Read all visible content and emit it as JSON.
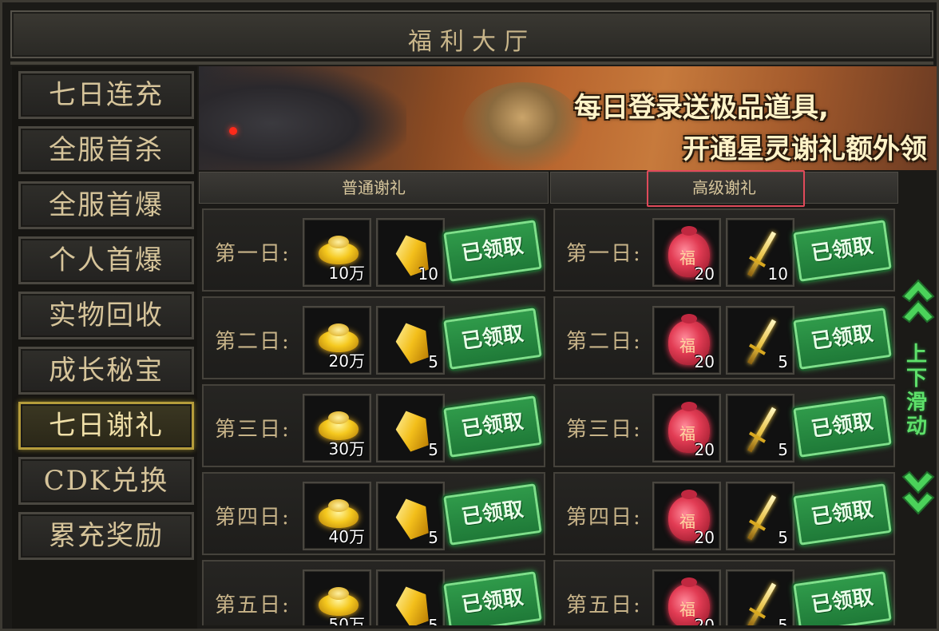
{
  "window": {
    "title": "福利大厅"
  },
  "sidebar": {
    "items": [
      {
        "label": "七日连充",
        "active": false
      },
      {
        "label": "全服首杀",
        "active": false
      },
      {
        "label": "全服首爆",
        "active": false
      },
      {
        "label": "个人首爆",
        "active": false
      },
      {
        "label": "实物回收",
        "active": false
      },
      {
        "label": "成长秘宝",
        "active": false
      },
      {
        "label": "七日谢礼",
        "active": true
      },
      {
        "label": "CDK兑换",
        "active": false
      },
      {
        "label": "累充奖励",
        "active": false
      }
    ]
  },
  "banner": {
    "line1": "每日登录送极品道具,",
    "line2": "开通星灵谢礼额外领取高级谢礼!"
  },
  "columns": {
    "normal": {
      "label": "普通谢礼"
    },
    "advanced": {
      "label": "高级谢礼"
    }
  },
  "claimed_label": "已领取",
  "normal_rows": [
    {
      "day": "第一日:",
      "items": [
        {
          "icon": "gold-ingot-icon",
          "qty": "10万"
        },
        {
          "icon": "gold-crystal-icon",
          "qty": "10"
        }
      ],
      "status": "已领取"
    },
    {
      "day": "第二日:",
      "items": [
        {
          "icon": "gold-ingot-icon",
          "qty": "20万"
        },
        {
          "icon": "gold-crystal-icon",
          "qty": "5"
        }
      ],
      "status": "已领取"
    },
    {
      "day": "第三日:",
      "items": [
        {
          "icon": "gold-ingot-icon",
          "qty": "30万"
        },
        {
          "icon": "gold-crystal-icon",
          "qty": "5"
        }
      ],
      "status": "已领取"
    },
    {
      "day": "第四日:",
      "items": [
        {
          "icon": "gold-ingot-icon",
          "qty": "40万"
        },
        {
          "icon": "gold-crystal-icon",
          "qty": "5"
        }
      ],
      "status": "已领取"
    },
    {
      "day": "第五日:",
      "items": [
        {
          "icon": "gold-ingot-icon",
          "qty": "50万"
        },
        {
          "icon": "gold-crystal-icon",
          "qty": "5"
        }
      ],
      "status": "已领取"
    }
  ],
  "advanced_rows": [
    {
      "day": "第一日:",
      "items": [
        {
          "icon": "red-lucky-bag-icon",
          "qty": "20"
        },
        {
          "icon": "golden-sword-icon",
          "qty": "10"
        }
      ],
      "status": "已领取"
    },
    {
      "day": "第二日:",
      "items": [
        {
          "icon": "red-lucky-bag-icon",
          "qty": "20"
        },
        {
          "icon": "golden-sword-icon",
          "qty": "5"
        }
      ],
      "status": "已领取"
    },
    {
      "day": "第三日:",
      "items": [
        {
          "icon": "red-lucky-bag-icon",
          "qty": "20"
        },
        {
          "icon": "golden-sword-icon",
          "qty": "5"
        }
      ],
      "status": "已领取"
    },
    {
      "day": "第四日:",
      "items": [
        {
          "icon": "red-lucky-bag-icon",
          "qty": "20"
        },
        {
          "icon": "golden-sword-icon",
          "qty": "5"
        }
      ],
      "status": "已领取"
    },
    {
      "day": "第五日:",
      "items": [
        {
          "icon": "red-lucky-bag-icon",
          "qty": "20"
        },
        {
          "icon": "golden-sword-icon",
          "qty": "5"
        }
      ],
      "status": "已领取"
    }
  ],
  "scroll": {
    "label_chars": [
      "上",
      "下",
      "滑",
      "动"
    ],
    "up_icon": "double-chevron-up-icon",
    "down_icon": "double-chevron-down-icon"
  },
  "colors": {
    "gold_text": "#d6c49a",
    "active_border": "#b59c3b",
    "claimed_green": "#2f9a4a",
    "scroll_green": "#5ee06a",
    "highlight_red": "#e04a5a"
  }
}
